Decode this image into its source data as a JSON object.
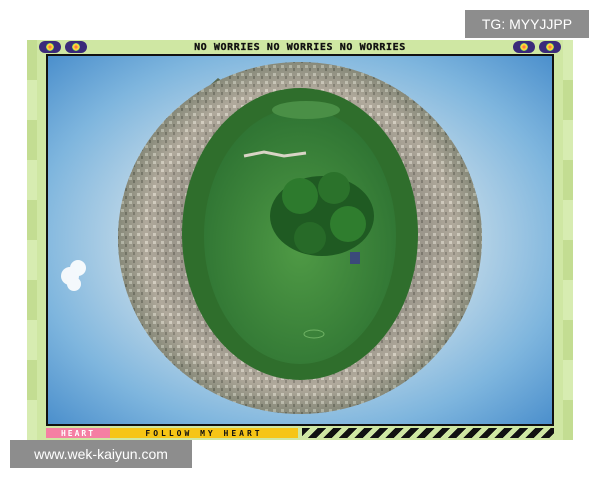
{
  "watermarks": {
    "tg_label": "TG: MYYJJPP",
    "url_label": "www.wek-kaiyun.com"
  },
  "poster": {
    "top_text": "NO WORRIES NO WORRIES NO WORRIES",
    "bottom_left_label": "HEART",
    "bottom_middle_label": "FOLLOW MY HEART",
    "badge_icons": [
      "rainbow-badge-icon",
      "rainbow-badge-icon",
      "rainbow-badge-icon",
      "rainbow-badge-icon"
    ],
    "photo_subject": "tiny-planet aerial view of a green lake with an island, ringed by trees, city buildings and karst mountains",
    "colors": {
      "frame_green": "#cfe7a3",
      "heart_pink": "#f57fa3",
      "follow_yellow": "#f6c515",
      "sky_blue": "#6aa9d8",
      "lake_green": "#3f8a3a",
      "watermark_gray": "#8d8d8d"
    }
  }
}
